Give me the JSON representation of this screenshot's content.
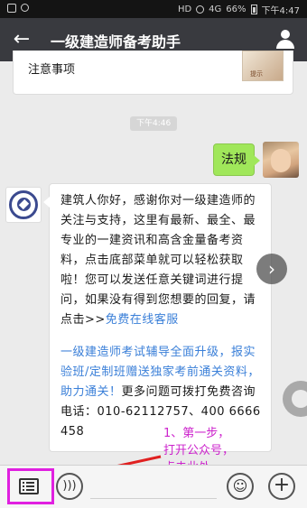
{
  "status_bar": {
    "time": "下午4:47",
    "battery_percent": "66%",
    "network_label": "4G",
    "signal_label": "HD"
  },
  "header": {
    "back_icon": "back-arrow-icon",
    "title": "一级建造师备考助手",
    "profile_icon": "person-icon"
  },
  "chat": {
    "prev_card_text": "注意事项",
    "prev_card_thumb_label": "提示",
    "timestamp": "下午4:46",
    "user_message": "法规",
    "bot_message": {
      "line1_prefix": "建筑人你好，感谢你对一级建造师的关注与支持，这里有最新、最全、最专业的一建资讯和高含金量备考资料，点击底部菜单就可以轻松获取啦！您可以发送任意关键词进行提问，如果没有得到您想要的回复，请点击>>",
      "link_text": "免费在线客服",
      "paragraph2": "一级建造师考试辅导全面升级，报实验班/定制班赠送独家考前通关资料，助力通关！",
      "paragraph2_tail": "更多问题可拨打免费咨询电话：010-62112757、400 6666 458"
    }
  },
  "annotation": {
    "lines": [
      "1、第一步，",
      "打开公众号，",
      "点击此处"
    ],
    "color": "#cc22cc"
  },
  "bottom_bar": {
    "menu_icon": "menu-list-icon",
    "voice_icon": "voice-icon",
    "emoji_icon": "emoji-icon",
    "plus_icon": "plus-icon",
    "input_placeholder": ""
  }
}
